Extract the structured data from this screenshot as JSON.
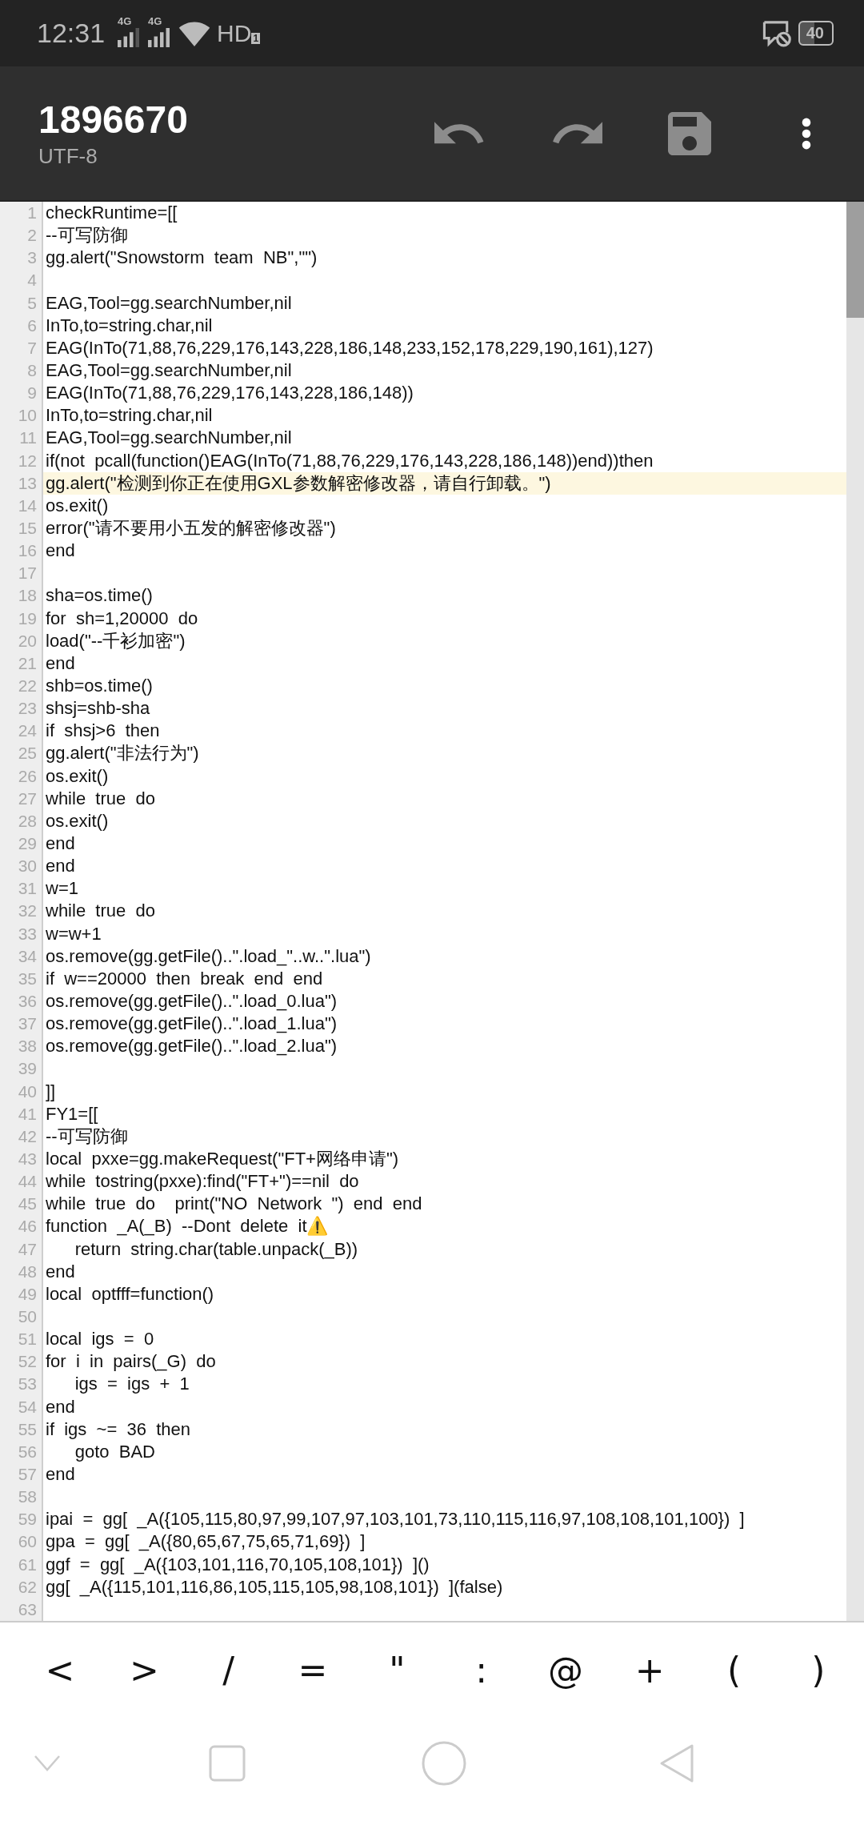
{
  "status_bar": {
    "time": "12:31",
    "network_1": "4G",
    "network_2": "4G",
    "hd": "HD",
    "hd_slot": "1",
    "battery": "40"
  },
  "toolbar": {
    "title": "1896670",
    "subtitle": "UTF-8"
  },
  "editor": {
    "lines": [
      {
        "number": "1",
        "text": "checkRuntime=[[",
        "current": false
      },
      {
        "number": "2",
        "text": "--可写防御",
        "current": false
      },
      {
        "number": "3",
        "text": "gg.alert(\"Snowstorm  team  NB\",\"\")",
        "current": false
      },
      {
        "number": "4",
        "current": false
      },
      {
        "number": "5",
        "text": "EAG,Tool=gg.searchNumber,nil",
        "current": false
      },
      {
        "number": "6",
        "text": "InTo,to=string.char,nil",
        "current": false
      },
      {
        "number": "7",
        "text": "EAG(InTo(71,88,76,229,176,143,228,186,148,233,152,178,229,190,161),127)",
        "current": false
      },
      {
        "number": "8",
        "text": "EAG,Tool=gg.searchNumber,nil",
        "current": false
      },
      {
        "number": "9",
        "text": "EAG(InTo(71,88,76,229,176,143,228,186,148))",
        "current": false
      },
      {
        "number": "10",
        "text": "InTo,to=string.char,nil",
        "current": false
      },
      {
        "number": "11",
        "text": "EAG,Tool=gg.searchNumber,nil",
        "current": false
      },
      {
        "number": "12",
        "text": "if(not  pcall(function()EAG(InTo(71,88,76,229,176,143,228,186,148))end))then",
        "current": false
      },
      {
        "number": "13",
        "text": "gg.alert(\"检测到你正在使用GXL参数解密修改器，请自行卸载。\")",
        "current": true
      },
      {
        "number": "14",
        "text": "os.exit()",
        "current": false
      },
      {
        "number": "15",
        "text": "error(\"请不要用小五发的解密修改器\")",
        "current": false
      },
      {
        "number": "16",
        "text": "end",
        "current": false
      },
      {
        "number": "17",
        "current": false
      },
      {
        "number": "18",
        "text": "sha=os.time()",
        "current": false
      },
      {
        "number": "19",
        "text": "for  sh=1,20000  do",
        "current": false
      },
      {
        "number": "20",
        "text": "load(\"--千衫加密\")",
        "current": false
      },
      {
        "number": "21",
        "text": "end",
        "current": false
      },
      {
        "number": "22",
        "text": "shb=os.time()",
        "current": false
      },
      {
        "number": "23",
        "text": "shsj=shb-sha",
        "current": false
      },
      {
        "number": "24",
        "text": "if  shsj>6  then",
        "current": false
      },
      {
        "number": "25",
        "text": "gg.alert(\"非法行为\")",
        "current": false
      },
      {
        "number": "26",
        "text": "os.exit()",
        "current": false
      },
      {
        "number": "27",
        "text": "while  true  do",
        "current": false
      },
      {
        "number": "28",
        "text": "os.exit()",
        "current": false
      },
      {
        "number": "29",
        "text": "end",
        "current": false
      },
      {
        "number": "30",
        "text": "end",
        "current": false
      },
      {
        "number": "31",
        "text": "w=1",
        "current": false
      },
      {
        "number": "32",
        "text": "while  true  do",
        "current": false
      },
      {
        "number": "33",
        "text": "w=w+1",
        "current": false
      },
      {
        "number": "34",
        "text": "os.remove(gg.getFile()..\".load_\"..w..\".lua\")",
        "current": false
      },
      {
        "number": "35",
        "text": "if  w==20000  then  break  end  end",
        "current": false
      },
      {
        "number": "36",
        "text": "os.remove(gg.getFile()..\".load_0.lua\")",
        "current": false
      },
      {
        "number": "37",
        "text": "os.remove(gg.getFile()..\".load_1.lua\")",
        "current": false
      },
      {
        "number": "38",
        "text": "os.remove(gg.getFile()..\".load_2.lua\")",
        "current": false
      },
      {
        "number": "39",
        "current": false
      },
      {
        "number": "40",
        "text": "]]",
        "current": false
      },
      {
        "number": "41",
        "text": "FY1=[[",
        "current": false
      },
      {
        "number": "42",
        "text": "--可写防御",
        "current": false
      },
      {
        "number": "43",
        "text": "local  pxxe=gg.makeRequest(\"FT+网络申请\")",
        "current": false
      },
      {
        "number": "44",
        "text": "while  tostring(pxxe):find(\"FT+\")==nil  do",
        "current": false
      },
      {
        "number": "45",
        "text": "while  true  do    print(\"NO  Network  \")  end  end",
        "current": false
      },
      {
        "number": "46",
        "text": "function  _A(_B)  --Dont  delete  it⚠️",
        "current": false
      },
      {
        "number": "47",
        "text": "      return  string.char(table.unpack(_B))",
        "current": false
      },
      {
        "number": "48",
        "text": "end",
        "current": false
      },
      {
        "number": "49",
        "text": "local  optfff=function()",
        "current": false
      },
      {
        "number": "50",
        "current": false
      },
      {
        "number": "51",
        "text": "local  igs  =  0",
        "current": false
      },
      {
        "number": "52",
        "text": "for  i  in  pairs(_G)  do",
        "current": false
      },
      {
        "number": "53",
        "text": "      igs  =  igs  +  1",
        "current": false
      },
      {
        "number": "54",
        "text": "end",
        "current": false
      },
      {
        "number": "55",
        "text": "if  igs  ~=  36  then",
        "current": false
      },
      {
        "number": "56",
        "text": "      goto  BAD",
        "current": false
      },
      {
        "number": "57",
        "text": "end",
        "current": false
      },
      {
        "number": "58",
        "current": false
      },
      {
        "number": "59",
        "text": "ipai  =  gg[  _A({105,115,80,97,99,107,97,103,101,73,110,115,116,97,108,108,101,100})  ]",
        "current": false
      },
      {
        "number": "60",
        "text": "gpa  =  gg[  _A({80,65,67,75,65,71,69})  ]",
        "current": false
      },
      {
        "number": "61",
        "text": "ggf  =  gg[  _A({103,101,116,70,105,108,101})  ]()",
        "current": false
      },
      {
        "number": "62",
        "text": "gg[  _A({115,101,116,86,105,115,105,98,108,101})  ](false)",
        "current": false
      },
      {
        "number": "63",
        "current": false
      }
    ]
  },
  "symbol_keys": [
    "<",
    ">",
    "/",
    "=",
    "\"",
    ":",
    "@",
    "+",
    "(",
    ")"
  ]
}
